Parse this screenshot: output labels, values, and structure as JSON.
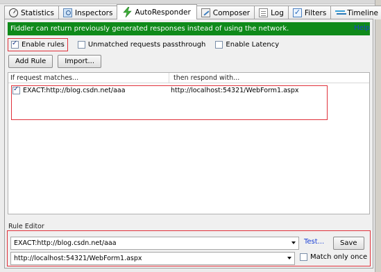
{
  "tabs": [
    {
      "label": "Statistics",
      "icon": "stopwatch-icon"
    },
    {
      "label": "Inspectors",
      "icon": "inspector-icon"
    },
    {
      "label": "AutoResponder",
      "icon": "lightning-icon",
      "active": true
    },
    {
      "label": "Composer",
      "icon": "composer-icon"
    },
    {
      "label": "Log",
      "icon": "log-icon"
    },
    {
      "label": "Filters",
      "icon": "checkbox-icon"
    },
    {
      "label": "Timeline",
      "icon": "timeline-icon"
    }
  ],
  "banner": {
    "text": "Fiddler can return previously generated responses instead of using the network.",
    "help": "Help",
    "color": "#0f8a1a"
  },
  "options": {
    "enable_rules": {
      "label": "Enable rules",
      "checked": true
    },
    "unmatched_passthrough": {
      "label": "Unmatched requests passthrough",
      "checked": false
    },
    "enable_latency": {
      "label": "Enable Latency",
      "checked": false
    }
  },
  "buttons": {
    "add_rule": "Add Rule",
    "import": "Import..."
  },
  "rules_list": {
    "columns": [
      "If request matches...",
      "then respond with..."
    ],
    "rows": [
      {
        "checked": true,
        "match": "EXACT:http://blog.csdn.net/aaa",
        "respond": "http://localhost:54321/WebForm1.aspx"
      }
    ]
  },
  "rule_editor": {
    "label": "Rule Editor",
    "match_value": "EXACT:http://blog.csdn.net/aaa",
    "respond_value": "http://localhost:54321/WebForm1.aspx",
    "test_link": "Test...",
    "save_label": "Save",
    "match_only_once": {
      "label": "Match only once",
      "checked": false
    }
  },
  "highlight_color": "#e0303a"
}
